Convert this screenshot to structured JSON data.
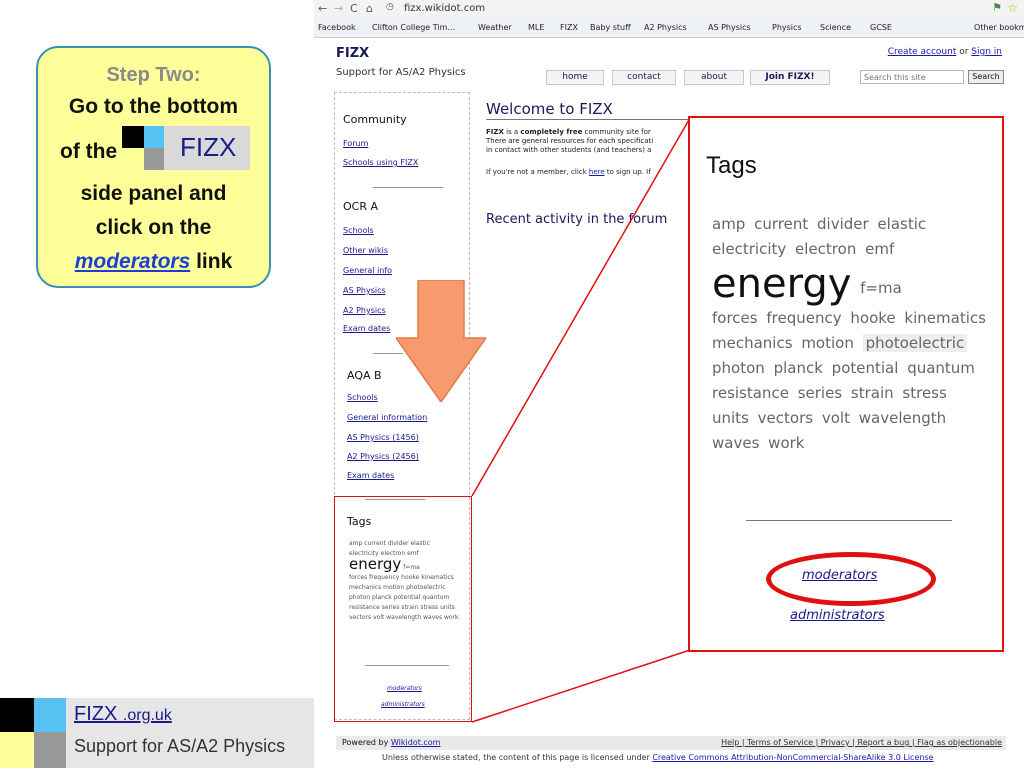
{
  "callout": {
    "step": "Step Two:",
    "line1": "Go to the bottom",
    "line2": "of the",
    "line3": "side panel and",
    "line4": "click on the",
    "link_word": "moderators",
    "link_suffix": " link",
    "logo_text": "FIZX"
  },
  "brand": {
    "name": "FIZX",
    "suffix": ".org.uk",
    "tagline": "Support for AS/A2 Physics"
  },
  "browser": {
    "url": "fizx.wikidot.com",
    "bookmarks": [
      "Facebook",
      "Clifton College Tim...",
      "Weather",
      "MLE",
      "FIZX",
      "Baby stuff",
      "A2 Physics",
      "AS Physics",
      "Physics",
      "Science",
      "GCSE",
      "Other bookm"
    ]
  },
  "site": {
    "title": "FIZX",
    "subtitle": "Support for AS/A2 Physics",
    "create_account": "Create account",
    "or": " or ",
    "sign_in": "Sign in",
    "nav": [
      "home",
      "contact",
      "about",
      "Join FIZX!"
    ],
    "search_placeholder": "Search this site",
    "search_button": "Search"
  },
  "side": {
    "community_heading": "Community",
    "community_links": [
      "Forum",
      "Schools using FIZX"
    ],
    "ocra_heading": "OCR A",
    "ocra_links": [
      "Schools",
      "Other wikis",
      "General info",
      "AS Physics",
      "A2 Physics",
      "Exam dates"
    ],
    "aqab_heading": "AQA B",
    "aqab_links": [
      "Schools",
      "General information",
      "AS Physics (1456)",
      "A2 Physics (2456)",
      "Exam dates"
    ],
    "tags_heading": "Tags",
    "moderators": "moderators",
    "administrators": "administrators"
  },
  "main": {
    "welcome": "Welcome to FIZX",
    "intro_1_bold": "FIZX",
    "intro_1_mid": " is a ",
    "intro_1_bold2": "completely free",
    "intro_1_end": " community site for",
    "intro_2": "There are general resources for each specificati",
    "intro_3": "in contact with other students (and teachers) a",
    "member_pre": "If you're not a member, click ",
    "member_link": "here",
    "member_post": " to sign up. If",
    "recent": "Recent activity in the forum"
  },
  "tags": {
    "title": "Tags",
    "items": [
      "amp",
      "current",
      "divider",
      "elastic",
      "electricity",
      "electron",
      "emf",
      "energy",
      "f=ma",
      "forces",
      "frequency",
      "hooke",
      "kinematics",
      "mechanics",
      "motion",
      "photoelectric",
      "photon",
      "planck",
      "potential",
      "quantum",
      "resistance",
      "series",
      "strain",
      "stress",
      "units",
      "vectors",
      "volt",
      "wavelength",
      "waves",
      "work"
    ],
    "big_tag": "energy",
    "highlighted_tag": "photoelectric",
    "moderators": "moderators",
    "administrators": "administrators"
  },
  "footer": {
    "powered_by": "Powered by ",
    "wikidot": "Wikidot.com",
    "links": "Help  |  Terms of Service  |  Privacy  |  Report a bug  |  Flag as objectionable",
    "license_pre": "Unless otherwise stated, the content of this page is licensed under ",
    "license_link": "Creative Commons Attribution-NonCommercial-ShareAlike 3.0 License"
  },
  "colors": {
    "callout_bg": "#ffff99",
    "callout_border": "#3a8fb7",
    "highlight_red": "#e01010",
    "arrow_orange": "#f79a6e",
    "logo_blue": "#57c3f0"
  }
}
